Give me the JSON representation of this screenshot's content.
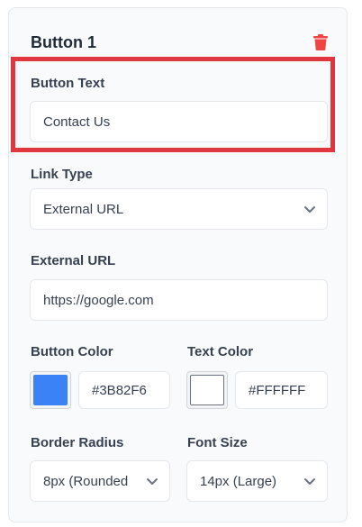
{
  "panel": {
    "title": "Button 1",
    "delete_icon": "trash-icon",
    "accent_delete": "#ef4444"
  },
  "button_text": {
    "label": "Button Text",
    "value": "Contact Us"
  },
  "link_type": {
    "label": "Link Type",
    "selected": "External URL"
  },
  "external_url": {
    "label": "External URL",
    "value": "https://google.com"
  },
  "button_color": {
    "label": "Button Color",
    "hex": "#3B82F6",
    "swatch": "#3b82f6"
  },
  "text_color": {
    "label": "Text Color",
    "hex": "#FFFFFF",
    "swatch": "#ffffff"
  },
  "border_radius": {
    "label": "Border Radius",
    "selected": "8px (Rounded"
  },
  "font_size": {
    "label": "Font Size",
    "selected": "14px (Large)"
  },
  "highlight_color": "#e0363f"
}
